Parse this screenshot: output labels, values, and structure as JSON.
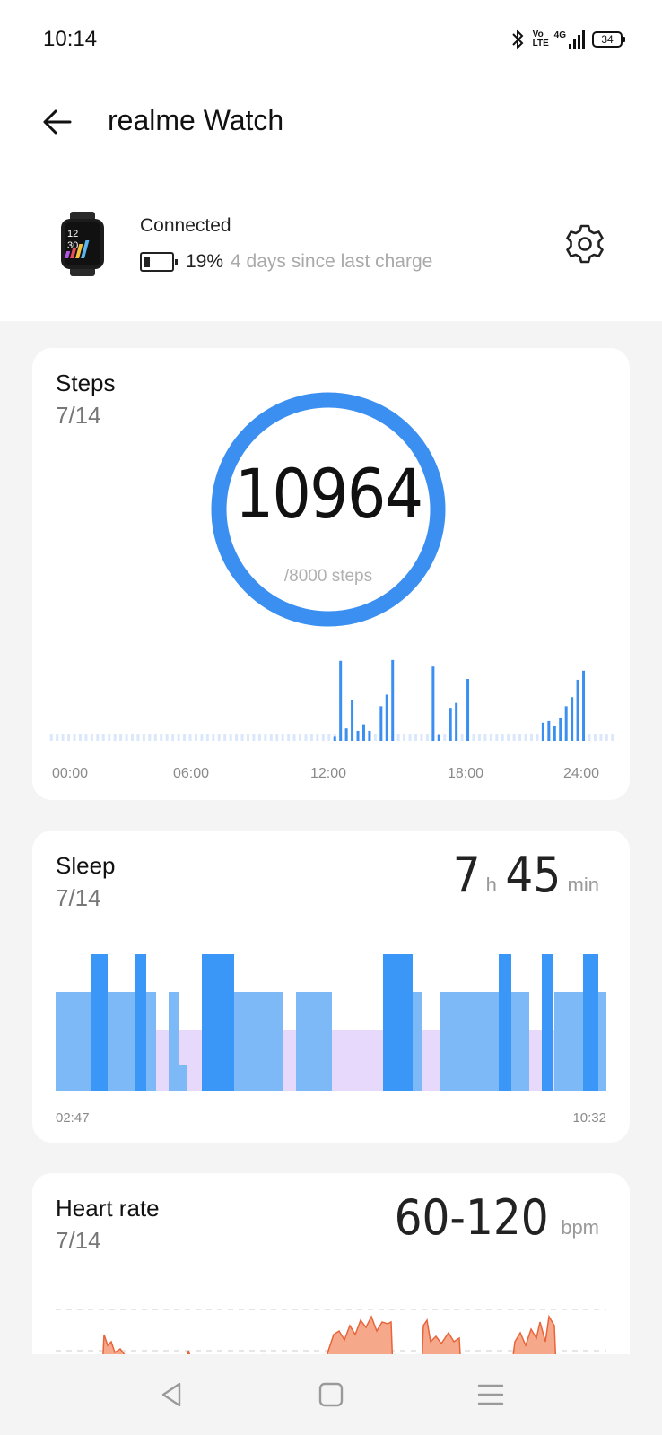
{
  "status_bar": {
    "time": "10:14",
    "volte": "Vo LTE",
    "network": "4G",
    "battery": "34"
  },
  "header": {
    "title": "realme Watch"
  },
  "device": {
    "watch_time_top": "12",
    "watch_time_bottom": "30",
    "status": "Connected",
    "battery_percent": "19%",
    "since_charge": "4 days since last charge"
  },
  "steps": {
    "title": "Steps",
    "date": "7/14",
    "value": "10964",
    "goal": "/8000 steps",
    "progress": 1.0,
    "accent": "#3b8ff0",
    "x_labels": [
      "00:00",
      "06:00",
      "12:00",
      "18:00",
      "24:00"
    ],
    "hourly": [
      0,
      0,
      0,
      0,
      0,
      0,
      0,
      0,
      0,
      0,
      0,
      0,
      0,
      0,
      0,
      0,
      0,
      0,
      0,
      0,
      0,
      0,
      0,
      0,
      0,
      0,
      0,
      0,
      0,
      0,
      0,
      0,
      0,
      0,
      0,
      0,
      0,
      0,
      0,
      0,
      0,
      0,
      0,
      0,
      0,
      0,
      0,
      0,
      0,
      0.05,
      0.97,
      0.15,
      0.5,
      0.12,
      0.2,
      0.12,
      0,
      0.42,
      0.56,
      0.98,
      0,
      0,
      0,
      0,
      0,
      0,
      0.9,
      0.08,
      0,
      0.4,
      0.46,
      0,
      0.75,
      0,
      0,
      0,
      0,
      0,
      0,
      0,
      0,
      0,
      0,
      0,
      0,
      0.22,
      0.24,
      0.18,
      0.28,
      0.42,
      0.53,
      0.74,
      0.85,
      0,
      0,
      0,
      0,
      0
    ]
  },
  "sleep": {
    "title": "Sleep",
    "date": "7/14",
    "hours": "7",
    "hours_unit": "h",
    "minutes": "45",
    "minutes_unit": "min",
    "start": "02:47",
    "end": "10:32",
    "colors": {
      "deep": "#3a96f7",
      "light": "#7db9f7",
      "awake": "#e7d9fb"
    }
  },
  "heart": {
    "title": "Heart rate",
    "date": "7/14",
    "range": "60-120",
    "unit": "bpm",
    "color": "#f08a62"
  }
}
